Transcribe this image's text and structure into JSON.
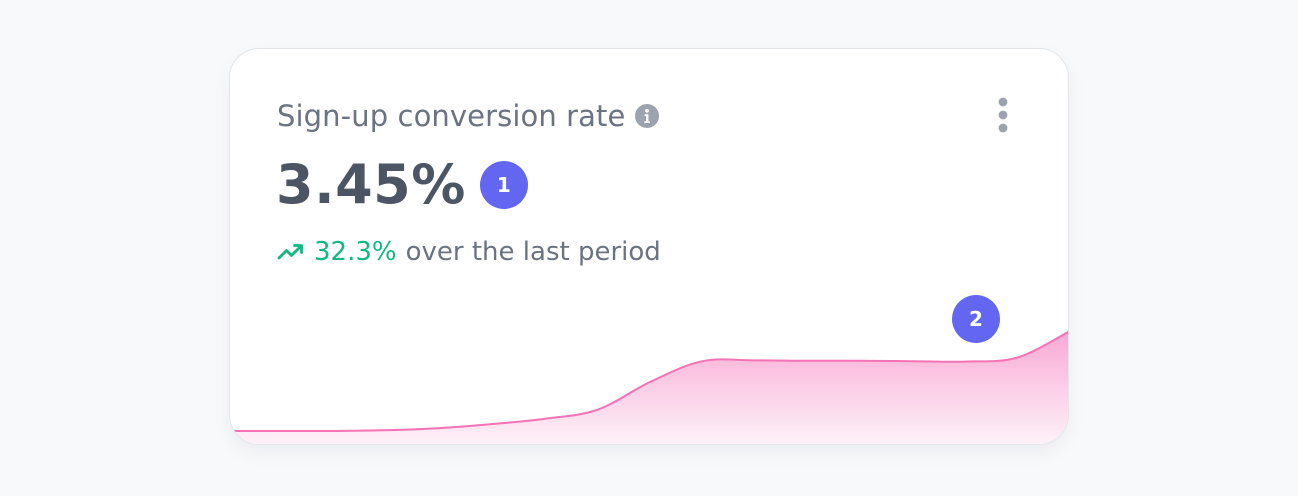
{
  "card": {
    "title": "Sign-up conversion rate",
    "info_icon": "info-icon",
    "menu_icon": "vertical-dots-icon",
    "value": "3.45%",
    "value_badge": "1",
    "trend": {
      "icon": "trending-up-icon",
      "value": "32.3%",
      "text": "over the last period",
      "color": "#10b981"
    },
    "chart_badge": "2"
  },
  "colors": {
    "badge": "#6366f1",
    "chart_line": "#f472b6",
    "chart_fill": "#f9a8d4",
    "background": "#f8f9fb",
    "card": "#ffffff"
  },
  "chart_data": {
    "type": "area",
    "x": [
      0,
      1,
      2,
      3,
      4,
      5,
      6,
      7,
      8,
      9,
      10,
      11,
      12,
      13,
      14,
      15,
      16
    ],
    "values": [
      0.5,
      0.5,
      0.5,
      0.7,
      1.2,
      2.2,
      3.5,
      5.7,
      12.5,
      17.6,
      17.8,
      17.7,
      17.7,
      17.6,
      17.5,
      18.5,
      25.0
    ],
    "ylim": [
      0,
      25
    ],
    "xlabel": "",
    "ylabel": "",
    "grid": false
  }
}
